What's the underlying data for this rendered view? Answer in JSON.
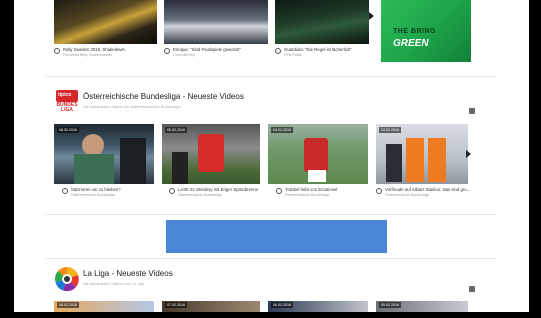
{
  "top_row": {
    "videos": [
      {
        "title": "Rally Sweden 2016: Shakedown",
        "sub": "FIA World Rally Championship"
      },
      {
        "title": "Enrique: \"Sind Finalspiele gewohnt\"",
        "sub": "Copa del Rey"
      },
      {
        "title": "Guardiola: \"Die Regel ist lächerlich\"",
        "sub": "DFB-Pokal"
      }
    ],
    "ad_text_top": "THE BRING",
    "ad_text_bottom": "GREEN"
  },
  "bundesliga": {
    "logo_text_top": "tipico",
    "logo_text_bottom": "BUNDES LIGA",
    "title": "Österreichische Bundesliga - Neueste Videos",
    "subtitle": "Die aktuellsten Videos der österreichischen Bundesliga",
    "videos": [
      {
        "date": "08.02.2016",
        "title": "Salzmmer um zu bleiben?",
        "sub": "Österreichische Bundesliga"
      },
      {
        "date": "05.02.2016",
        "title": "LASK 61 Weidnsy mit Eriger Sprünbrenno",
        "sub": "Österreichische Bundesliga"
      },
      {
        "date": "04.02.2016",
        "title": "Trubbel hebt von Emotionel",
        "sub": "Österreichische Bundesliga"
      },
      {
        "date": "03.02.2016",
        "title": "Vorfreude auf Allianz Stadion: Das sind gro...",
        "sub": "Österreichische Bundesliga"
      }
    ]
  },
  "laliga": {
    "title": "La Liga - Neueste Videos",
    "subtitle": "Die aktuellsten Videos von La Liga",
    "dates": [
      "08.02.2016",
      "07.02.2016",
      "06.02.2016",
      "05.02.2016"
    ]
  },
  "colors": {
    "banner": "#4a86d8",
    "ad_green": "#1ea64a"
  }
}
